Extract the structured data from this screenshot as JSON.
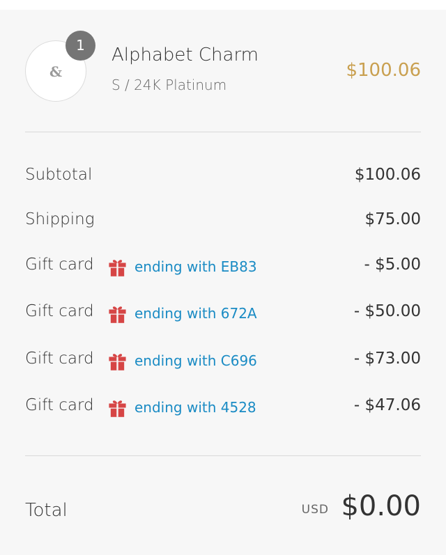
{
  "product": {
    "quantity": "1",
    "name": "Alphabet Charm",
    "variant": "S / 24K Platinum",
    "price": "$100.06",
    "thumbnail_icon": "charm-ampersand-icon",
    "price_color": "#c9a050"
  },
  "summary": {
    "subtotal": {
      "label": "Subtotal",
      "value": "$100.06"
    },
    "shipping": {
      "label": "Shipping",
      "value": "$75.00"
    },
    "gift_cards": [
      {
        "label": "Gift card",
        "code": "ending with EB83",
        "value": "- $5.00"
      },
      {
        "label": "Gift card",
        "code": "ending with 672A",
        "value": "- $50.00"
      },
      {
        "label": "Gift card",
        "code": "ending with C696",
        "value": "- $73.00"
      },
      {
        "label": "Gift card",
        "code": "ending with 4528",
        "value": "- $47.06"
      }
    ],
    "gift_icon": "gift-icon",
    "gift_icon_color": "#d64545",
    "gift_link_color": "#1a8bc4"
  },
  "total": {
    "label": "Total",
    "currency": "USD",
    "amount": "$0.00"
  }
}
